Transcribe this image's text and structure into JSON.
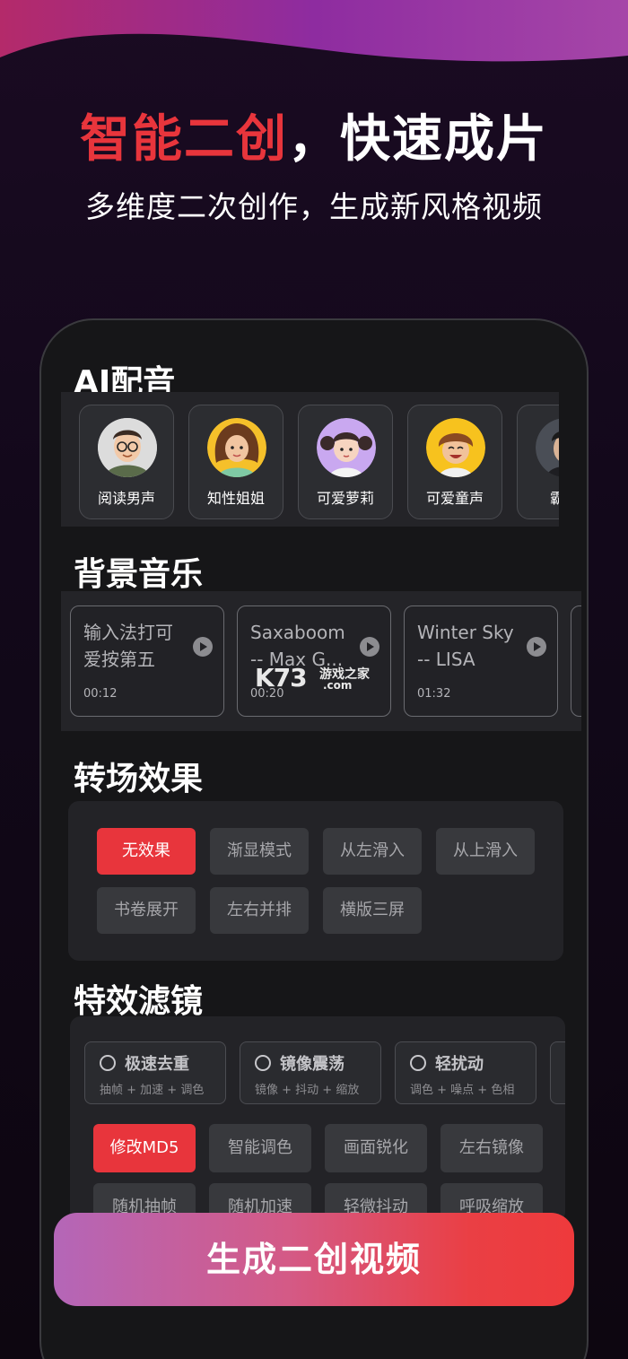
{
  "colors": {
    "accent": "#e8353c",
    "panel": "#232327",
    "chip": "#38393d"
  },
  "header": {
    "title_accent": "智能二创",
    "title_rest": "，快速成片",
    "subtitle": "多维度二次创作，生成新风格视频"
  },
  "voice": {
    "title": "AI配音",
    "items": [
      {
        "label": "阅读男声",
        "icon": "man-glasses-avatar"
      },
      {
        "label": "知性姐姐",
        "icon": "woman-curly-avatar"
      },
      {
        "label": "可爱萝莉",
        "icon": "girl-pigtails-avatar"
      },
      {
        "label": "可爱童声",
        "icon": "child-curly-avatar"
      },
      {
        "label": "霸道",
        "icon": "man-dark-avatar"
      }
    ]
  },
  "music": {
    "title": "背景音乐",
    "items": [
      {
        "title": "输入法打可爱按第五",
        "time": "00:12"
      },
      {
        "title": "Saxaboom -- Max G...",
        "time": "00:20"
      },
      {
        "title": "Winter Sky -- LISA",
        "time": "01:32"
      }
    ]
  },
  "watermark": {
    "logo": "K73",
    "cn": "游戏之家",
    "com": ".com"
  },
  "transition": {
    "title": "转场效果",
    "items": [
      {
        "label": "无效果",
        "active": true
      },
      {
        "label": "渐显模式",
        "active": false
      },
      {
        "label": "从左滑入",
        "active": false
      },
      {
        "label": "从上滑入",
        "active": false
      },
      {
        "label": "书卷展开",
        "active": false
      },
      {
        "label": "左右并排",
        "active": false
      },
      {
        "label": "横版三屏",
        "active": false
      }
    ]
  },
  "filter": {
    "title": "特效滤镜",
    "presets": [
      {
        "name": "极速去重",
        "desc": "抽帧 + 加速 + 调色"
      },
      {
        "name": "镜像震荡",
        "desc": "镜像 + 抖动 + 缩放"
      },
      {
        "name": "轻扰动",
        "desc": "调色 + 噪点 + 色相"
      }
    ],
    "chips": [
      {
        "label": "修改MD5",
        "active": true
      },
      {
        "label": "智能调色",
        "active": false
      },
      {
        "label": "画面锐化",
        "active": false
      },
      {
        "label": "左右镜像",
        "active": false
      },
      {
        "label": "随机抽帧",
        "active": false
      },
      {
        "label": "随机加速",
        "active": false
      },
      {
        "label": "轻微抖动",
        "active": false
      },
      {
        "label": "呼吸缩放",
        "active": false
      }
    ]
  },
  "generate_label": "生成二创视频"
}
